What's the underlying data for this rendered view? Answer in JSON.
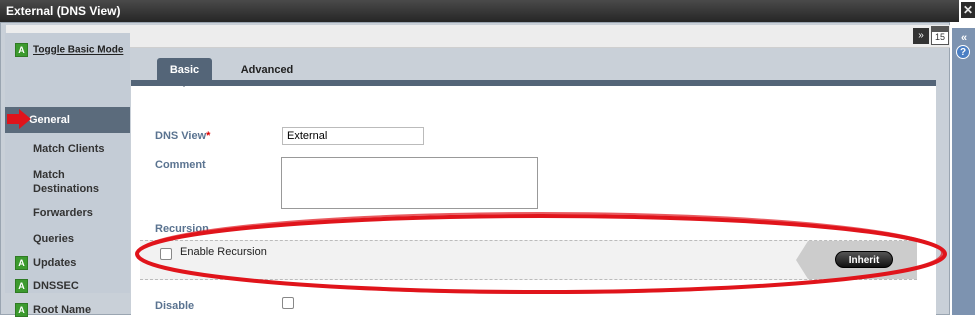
{
  "window": {
    "title": "External (DNS View)",
    "close_label": "✕"
  },
  "toolbar": {
    "collapse_icon": "double-chevron-down-icon",
    "calendar_day": "15"
  },
  "sidebar": {
    "toggle_badge": "A",
    "toggle_label": "Toggle Basic Mode",
    "active_item": "General",
    "items": [
      "Match Clients",
      "Match",
      "Destinations",
      "Forwarders",
      "Queries"
    ],
    "advanced_items": [
      {
        "badge": "A",
        "label": "Updates"
      },
      {
        "badge": "A",
        "label": "DNSSEC"
      },
      {
        "badge": "A",
        "label": "Root Name"
      }
    ]
  },
  "tabs": {
    "basic": "Basic",
    "advanced": "Advanced"
  },
  "form": {
    "dns_view_label": "DNS View",
    "required_mark": "*",
    "dns_view_value": "External",
    "comment_label": "Comment",
    "comment_value": "",
    "recursion_label": "Recursion",
    "enable_recursion_label": "Enable Recursion",
    "enable_recursion_checked": false,
    "inherit_label": "Inherit",
    "disable_label": "Disable",
    "disable_checked": false
  },
  "right_rail": {
    "collapse_label": "«",
    "help_label": "?"
  },
  "colors": {
    "annotation_red": "#e0141b",
    "active_nav": "#5b6b7c",
    "badge_green": "#3c9a2e"
  }
}
